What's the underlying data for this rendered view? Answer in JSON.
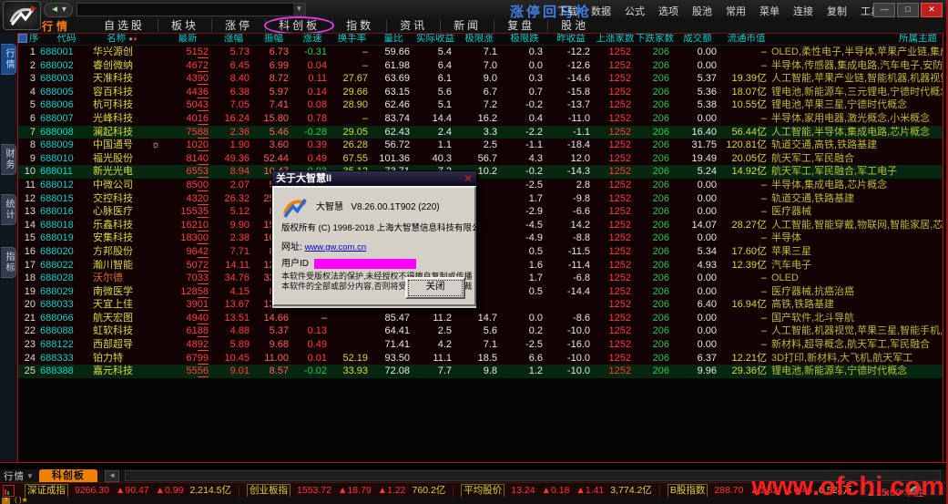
{
  "window": {
    "menu_items": [
      "下载",
      "数据",
      "公式",
      "选项",
      "股池",
      "常用",
      "菜单",
      "连接",
      "复制",
      "工具"
    ],
    "minimize": "—",
    "maximize": "□",
    "close": "✕",
    "main_title": "涨停回马枪"
  },
  "nav": {
    "home": "行情",
    "items": [
      "自选股",
      "板块",
      "涨停",
      "科创板",
      "指数",
      "资讯",
      "新闻",
      "复盘",
      "股池"
    ],
    "highlighted": "科创板"
  },
  "side_tabs": [
    "行情",
    "财务",
    "统计",
    "指标"
  ],
  "table": {
    "headers": [
      "序号",
      "代码",
      "名称",
      "",
      "最新",
      "涨幅",
      "振幅",
      "涨速",
      "换手率",
      "量比",
      "实际收益",
      "极限涨",
      "极限跌",
      "昨收益",
      "上涨家数",
      "下跌家数",
      "成交额",
      "流通市值",
      "所属主题"
    ],
    "seq_star": "★",
    "name_dot_gray": "●",
    "name_dot_red": "●",
    "rows": [
      [
        "1",
        "688001",
        "华兴源创",
        "",
        "51",
        "52",
        "5.73",
        "6.73",
        "-0.31",
        "–",
        "59.66",
        "5.4",
        "7.1",
        "0.3",
        "-12.2",
        "1252",
        "206",
        "0.00",
        "–",
        "OLED,柔性电子,半导体,苹果产业链,集成电路,苹果三星",
        ""
      ],
      [
        "2",
        "688002",
        "睿创微纳",
        "",
        "46",
        "72",
        "6.45",
        "6.99",
        "0.04",
        "–",
        "61.98",
        "6.4",
        "7.0",
        "0.0",
        "-12.6",
        "1252",
        "206",
        "0.00",
        "–",
        "半导体,传感器,集成电路,汽车电子,安防,航天军工,军民融合",
        ""
      ],
      [
        "3",
        "688003",
        "天准科技",
        "",
        "43",
        "90",
        "8.40",
        "8.72",
        "0.11",
        "27.67",
        "63.69",
        "6.1",
        "9.0",
        "0.3",
        "-14.6",
        "1252",
        "206",
        "5.37",
        "19.39亿",
        "人工智能,苹果产业链,智能机器,机器视觉,苹果三星",
        ""
      ],
      [
        "4",
        "688005",
        "容百科技",
        "",
        "44",
        "36",
        "6.38",
        "5.97",
        "0.14",
        "29.66",
        "63.15",
        "5.6",
        "6.7",
        "0.7",
        "-15.8",
        "1252",
        "206",
        "5.36",
        "18.07亿",
        "锂电池,新能源车,三元锂电,宁德时代概念",
        ""
      ],
      [
        "5",
        "688006",
        "杭可科技",
        "",
        "50",
        "43",
        "7.05",
        "7.41",
        "0.08",
        "28.90",
        "62.46",
        "5.1",
        "7.2",
        "-0.2",
        "-13.7",
        "1252",
        "206",
        "5.38",
        "10.55亿",
        "锂电池,苹果三星,宁德时代概念",
        ""
      ],
      [
        "6",
        "688007",
        "光峰科技",
        "",
        "40",
        "16",
        "16.24",
        "15.80",
        "0.78",
        "–",
        "83.74",
        "14.4",
        "16.2",
        "0.4",
        "-11.0",
        "1252",
        "206",
        "0.00",
        "–",
        "半导体,家用电器,激光概念,小米概念",
        ""
      ],
      [
        "7",
        "688008",
        "澜起科技",
        "",
        "75",
        "88",
        "2.36",
        "5.46",
        "-0.28",
        "29.05",
        "62.43",
        "2.4",
        "3.3",
        "-2.2",
        "-1.1",
        "1252",
        "206",
        "16.40",
        "56.44亿",
        "人工智能,半导体,集成电路,芯片概念",
        "g"
      ],
      [
        "8",
        "688009",
        "中国通号",
        "☼",
        "10",
        "20",
        "1.90",
        "3.60",
        "0.39",
        "26.28",
        "56.72",
        "1.1",
        "2.5",
        "-1.1",
        "-18.4",
        "1252",
        "206",
        "31.75",
        "120.81亿",
        "轨道交通,高铁,铁路基建",
        ""
      ],
      [
        "9",
        "688010",
        "福光股份",
        "",
        "81",
        "40",
        "49.36",
        "52.44",
        "0.49",
        "67.55",
        "101.36",
        "40.3",
        "56.7",
        "4.3",
        "12.0",
        "1252",
        "206",
        "19.49",
        "20.05亿",
        "航天军工,军民融合",
        ""
      ],
      [
        "10",
        "688011",
        "新光光电",
        "",
        "65",
        "53",
        "8.94",
        "10.47",
        "-0.03",
        "35.12",
        "73.71",
        "7.2",
        "10.2",
        "-0.2",
        "-14.3",
        "1252",
        "206",
        "5.24",
        "14.92亿",
        "航天军工,军民融合,军工电子",
        "g"
      ],
      [
        "11",
        "688012",
        "中微公司",
        "",
        "85",
        "00",
        "2.07",
        "5.74",
        "",
        "",
        "",
        "",
        "",
        "-2.5",
        "2.8",
        "1252",
        "206",
        "0.00",
        "–",
        "半导体,集成电路,芯片概念",
        ""
      ],
      [
        "12",
        "688015",
        "交控科技",
        "",
        "43",
        "20",
        "26.32",
        "25.50",
        "",
        "",
        "",
        "",
        "",
        "1.7",
        "-9.8",
        "1252",
        "206",
        "0.00",
        "–",
        "轨道交通,铁路基建",
        ""
      ],
      [
        "13",
        "688016",
        "心脉医疗",
        "",
        "155",
        "35",
        "5.12",
        "8.80",
        "",
        "",
        "",
        "",
        "",
        "-2.9",
        "-6.6",
        "1252",
        "206",
        "0.00",
        "–",
        "医疗器械",
        ""
      ],
      [
        "14",
        "688018",
        "乐鑫科技",
        "",
        "162",
        "10",
        "9.90",
        "15.74",
        "",
        "",
        "",
        "",
        "",
        "-4.5",
        "14.2",
        "1252",
        "206",
        "14.07",
        "28.27亿",
        "人工智能,智能穿戴,物联网,智能家居,芯片概念,小米概念",
        ""
      ],
      [
        "15",
        "688019",
        "安集科技",
        "",
        "183",
        "00",
        "2.38",
        "10.55",
        "",
        "",
        "",
        "",
        "",
        "-4.9",
        "-8.8",
        "1252",
        "206",
        "0.00",
        "–",
        "半导体",
        ""
      ],
      [
        "16",
        "688020",
        "方邦股份",
        "",
        "96",
        "42",
        "7.71",
        "8.24",
        "",
        "",
        "",
        "",
        "",
        "0.5",
        "-11.5",
        "1252",
        "206",
        "5.34",
        "17.60亿",
        "苹果三星",
        ""
      ],
      [
        "17",
        "688022",
        "瀚川智能",
        "",
        "50",
        "72",
        "14.11",
        "12.76",
        "",
        "",
        "",
        "",
        "",
        "1.6",
        "-11.4",
        "1252",
        "206",
        "4.93",
        "12.39亿",
        "汽车电子",
        ""
      ],
      [
        "18",
        "688028",
        "沃尔德",
        "",
        "70",
        "33",
        "34.76",
        "33.01",
        "",
        "",
        "",
        "",
        "",
        "1.7",
        "-6.8",
        "1252",
        "206",
        "0.00",
        "–",
        "OLED",
        "n"
      ],
      [
        "19",
        "688029",
        "南微医学",
        "",
        "128",
        "58",
        "4.15",
        "8.90",
        "",
        "",
        "",
        "",
        "",
        "0.5",
        "-14.4",
        "1252",
        "206",
        "0.00",
        "–",
        "医疗器械,抗癌治癌",
        ""
      ],
      [
        "20",
        "688033",
        "天宜上佳",
        "",
        "39",
        "01",
        "13.67",
        "13.69",
        "",
        "",
        "",
        "",
        "",
        "",
        "",
        "1252",
        "206",
        "6.40",
        "16.94亿",
        "高铁,铁路基建",
        ""
      ],
      [
        "21",
        "688066",
        "航天宏图",
        "",
        "49",
        "40",
        "13.51",
        "14.66",
        "–",
        "",
        "85.47",
        "11.2",
        "14.7",
        "0.0",
        "-8.6",
        "1252",
        "206",
        "0.00",
        "–",
        "国产软件,北斗导航",
        ""
      ],
      [
        "22",
        "688088",
        "虹软科技",
        "",
        "61",
        "88",
        "4.88",
        "5.37",
        "0.13",
        "",
        "64.41",
        "2.5",
        "5.6",
        "0.2",
        "-10.0",
        "1252",
        "206",
        "0.00",
        "–",
        "人工智能,机器视觉,苹果三星,智能手机,小米概念",
        ""
      ],
      [
        "23",
        "688122",
        "西部超导",
        "",
        "48",
        "92",
        "5.89",
        "9.68",
        "0.49",
        "",
        "71.41",
        "4.2",
        "7.1",
        "-2.5",
        "-16.0",
        "1252",
        "206",
        "0.00",
        "–",
        "新材料,超导概念,航天军工,军民融合",
        ""
      ],
      [
        "24",
        "688333",
        "铂力特",
        "",
        "67",
        "99",
        "10.45",
        "11.00",
        "0.01",
        "52.19",
        "93.50",
        "11.1",
        "18.5",
        "6.6",
        "-10.0",
        "1252",
        "206",
        "6.37",
        "12.21亿",
        "3D打印,新材料,大飞机,航天军工",
        ""
      ],
      [
        "25",
        "688388",
        "嘉元科技",
        "",
        "55",
        "56",
        "9.01",
        "8.57",
        "-0.02",
        "33.93",
        "72.08",
        "7.7",
        "9.8",
        "1.2",
        "-10.0",
        "1252",
        "206",
        "9.96",
        "29.36亿",
        "锂电池,新能源车,宁德时代概念",
        "g"
      ]
    ]
  },
  "dialog": {
    "title": "关于大智慧II",
    "close_icon": "✕",
    "app_name": "大智慧",
    "version": "V8.26.00.1T902 (220)",
    "copyright": "版权所有 (C) 1998-2018",
    "company": "上海大智慧信息科技有限公司",
    "url_label": "网址:",
    "url": "www.gw.com.cn",
    "user_id_label": "用户ID",
    "legal_line1": "本软件受版权法的保护,未经授权不得擅自复制或传播",
    "legal_line2": "本软件的全部或部分内容,否则将受到严厉的法律制裁",
    "close_button": "关闭"
  },
  "bottom": {
    "left_label": "行情",
    "active_tab": "科创板",
    "scroll_left_icon": "◄",
    "indices": [
      {
        "label": "深证成指",
        "value": "9266.30",
        "change": "▲90.47",
        "pct": "▲0.99",
        "amount": "2,214.5亿"
      },
      {
        "label": "创业板指",
        "value": "1553.72",
        "change": "▲18.79",
        "pct": "▲1.22",
        "amount": "760.2亿"
      },
      {
        "label": "平均股价",
        "value": "13.24",
        "change": "▲0.18",
        "pct": "▲1.41",
        "amount": "3,774.2亿"
      },
      {
        "label": "B股指数",
        "value": "288.70",
        "change": "▲1.32",
        "pct": "▲0.46",
        "amount": "0.524万"
      }
    ],
    "ticker": "▲15:00 华胜",
    "mini_marks": "( )★",
    "question_icon": "?",
    "watermark": "www.ofchi.com"
  },
  "colors": {
    "accent_red": "#ff3838",
    "accent_green": "#28c850",
    "accent_yellow": "#d8d830",
    "header_cyan": "#00c9c9",
    "code_cyan": "#00d2d2",
    "name_yellow": "#d8d840",
    "highlight_ellipse": "#e03ae0",
    "watermark_red": "#ff1e1e",
    "tab_orange": "#f08000"
  }
}
